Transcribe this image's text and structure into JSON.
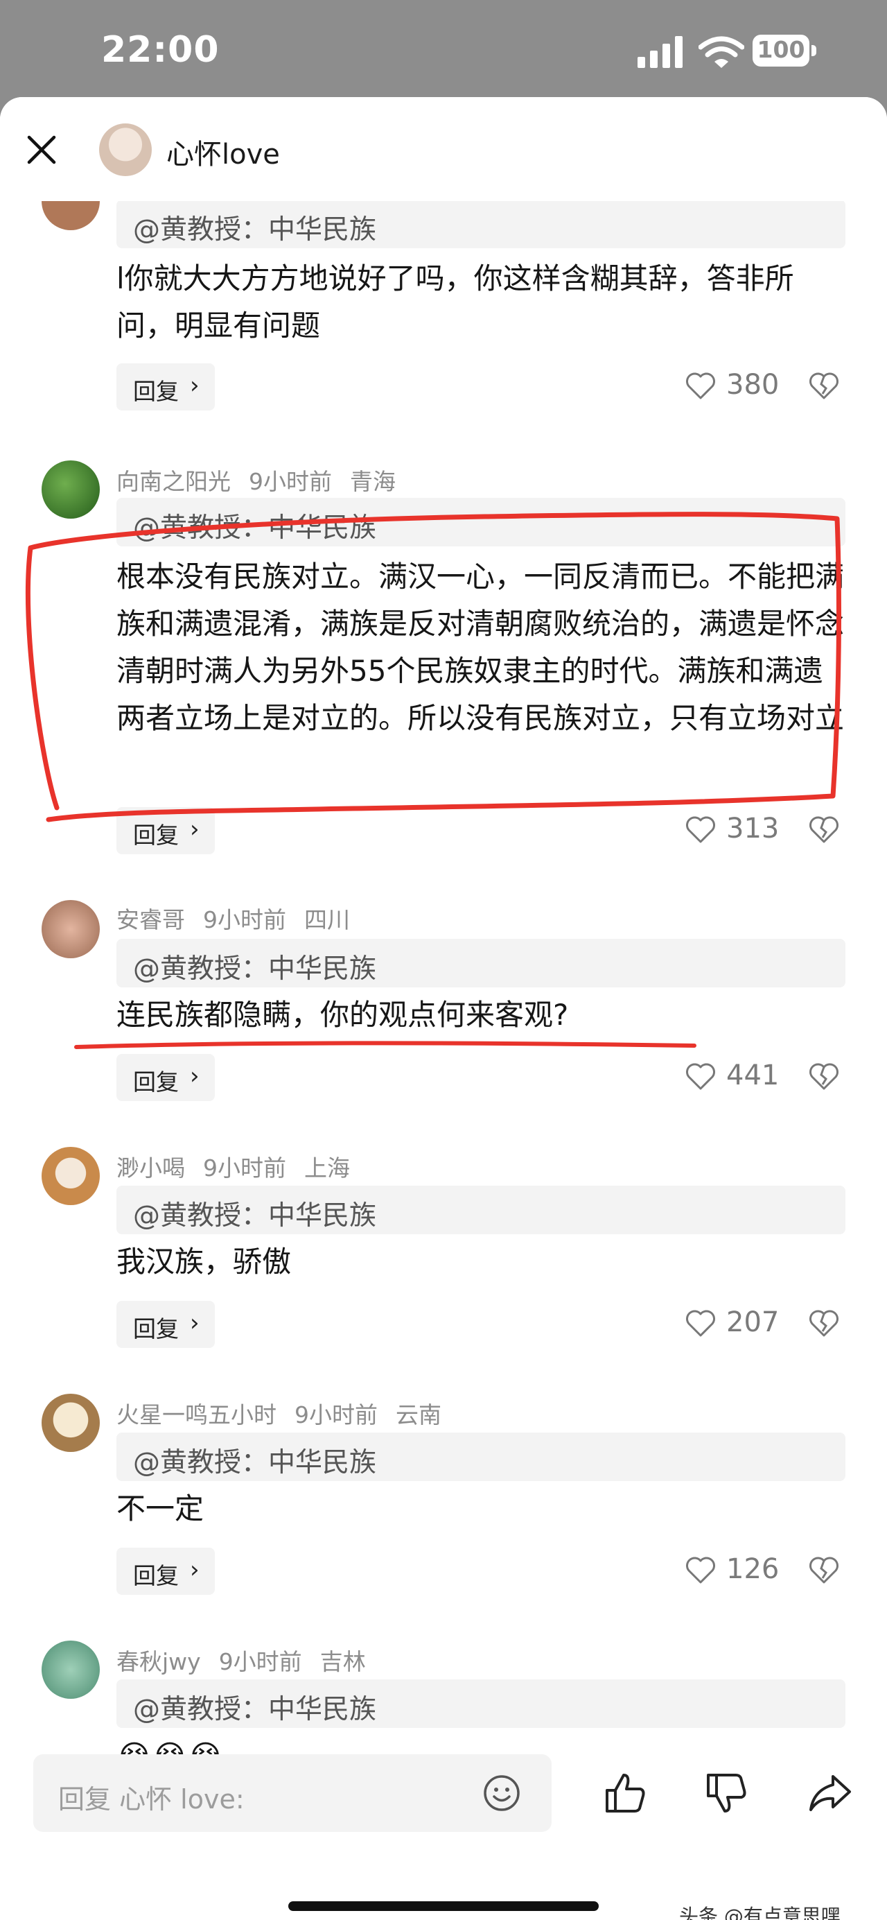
{
  "status": {
    "time": "22:00",
    "battery": "100"
  },
  "header": {
    "name": "心怀love"
  },
  "quote_text": "@黄教授：中华民族",
  "reply_label": "回复",
  "comments": [
    {
      "text": "l你就大大方方地说好了吗，你这样含糊其辞，答非所问，明显有问题",
      "likes": "380"
    },
    {
      "user": "向南之阳光",
      "time": "9小时前",
      "location": "青海",
      "text": "根本没有民族对立。满汉一心，一同反清而已。不能把满族和满遗混淆，满族是反对清朝腐败统治的，满遗是怀念清朝时满人为另外55个民族奴隶主的时代。满族和满遗两者立场上是对立的。所以没有民族对立，只有立场对立",
      "likes": "313"
    },
    {
      "user": "安睿哥",
      "time": "9小时前",
      "location": "四川",
      "text": "连民族都隐瞒，你的观点何来客观?",
      "likes": "441"
    },
    {
      "user": "渺小喝",
      "time": "9小时前",
      "location": "上海",
      "text": "我汉族，骄傲",
      "likes": "207"
    },
    {
      "user": "火星一鸣五小时",
      "time": "9小时前",
      "location": "云南",
      "text": "不一定",
      "likes": "126"
    },
    {
      "user": "春秋jwy",
      "time": "9小时前",
      "location": "吉林",
      "text": "😭😭😭"
    }
  ],
  "bottom": {
    "input_placeholder": "回复 心怀 love:",
    "watermark": "头条 @有点意思嘿"
  },
  "colors": {
    "annotation_red": "#e8332b",
    "status_gray": "#8d8d8d"
  },
  "icons": [
    "signal-icon",
    "wifi-icon",
    "close-icon",
    "heart-icon",
    "broken-heart-icon",
    "emoji-icon",
    "thumb-up-icon",
    "thumb-down-icon",
    "share-icon"
  ]
}
